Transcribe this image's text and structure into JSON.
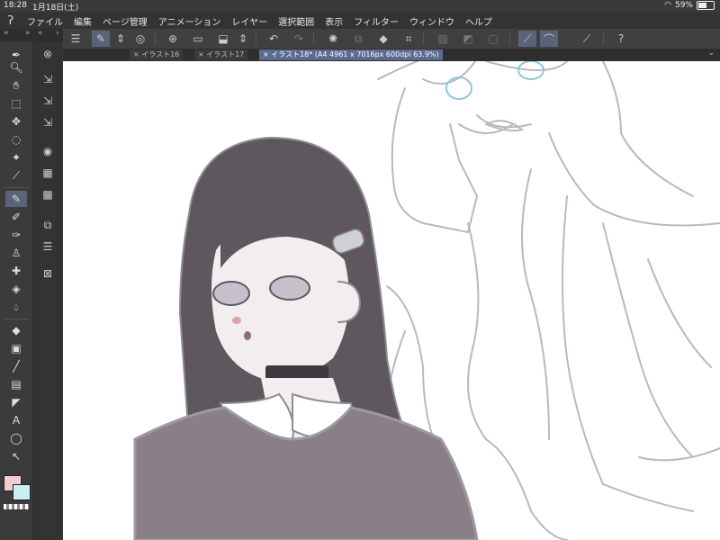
{
  "status": {
    "time": "18:28",
    "date": "1月18日(土)",
    "battery": "59%"
  },
  "menu": {
    "items": [
      "ファイル",
      "編集",
      "ページ管理",
      "アニメーション",
      "レイヤー",
      "選択範囲",
      "表示",
      "フィルター",
      "ウィンドウ",
      "ヘルプ"
    ]
  },
  "tabs": [
    {
      "label": "イラスト16"
    },
    {
      "label": "イラスト17"
    },
    {
      "label": "イラスト18* (A4 4961 x 7016px 600dpi 63.9%)"
    }
  ],
  "colors": {
    "main": "#f6ccd3",
    "sub": "#c9eef3",
    "accent": "#5a6378"
  }
}
